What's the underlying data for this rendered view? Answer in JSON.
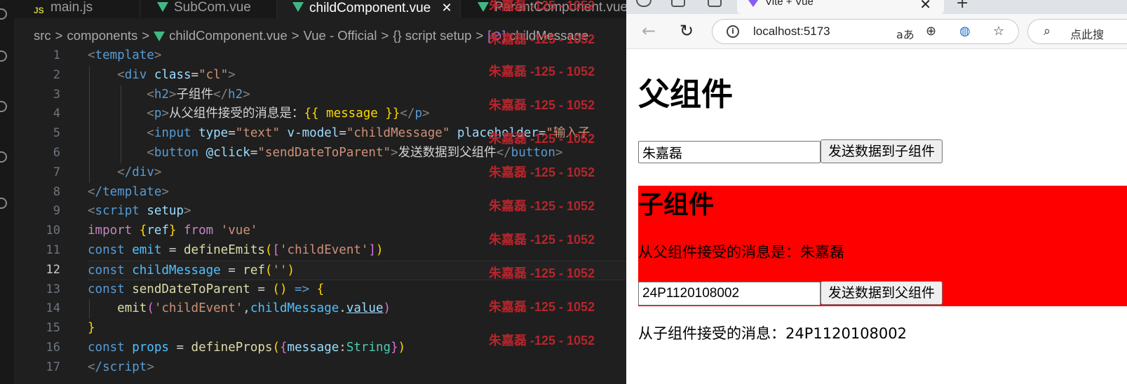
{
  "editor": {
    "tabs": [
      {
        "label": "main.js",
        "icon": "js-icon"
      },
      {
        "label": "SubCom.vue",
        "icon": "vue-icon"
      },
      {
        "label": "childComponent.vue",
        "icon": "vue-icon",
        "active": true
      },
      {
        "label": "ParentComponent.vue",
        "icon": "vue-icon"
      }
    ],
    "breadcrumb": [
      "src",
      "components",
      "childComponent.vue",
      "Vue - Official",
      "{} script setup",
      "childMessage"
    ],
    "line_numbers": [
      "1",
      "2",
      "3",
      "4",
      "5",
      "6",
      "7",
      "8",
      "9",
      "10",
      "11",
      "12",
      "13",
      "14",
      "15",
      "16",
      "17"
    ],
    "current_line": "12",
    "code": {
      "l1_tag": "template",
      "l2_tag": "div",
      "l2_attr": "class",
      "l2_val": "\"cl\"",
      "l3_tag": "h2",
      "l3_text": "子组件",
      "l4_tag": "p",
      "l4_text": "从父组件接受的消息是：",
      "l4_expr": "{{ message }}",
      "l5_tag": "input",
      "l5_a1": "type",
      "l5_v1": "\"text\"",
      "l5_a2": "v-model",
      "l5_v2": "\"childMessage\"",
      "l5_a3": "placeholder",
      "l5_v3": "\"输入子",
      "l6_tag": "button",
      "l6_attr": "@click",
      "l6_val": "\"sendDateToParent\"",
      "l6_text": "发送数据到父组件",
      "l7_tag": "/div",
      "l8_tag": "/template",
      "l9_tag": "script",
      "l9_attr": "setup",
      "l10_kw": "import",
      "l10_name": "ref",
      "l10_from": "from",
      "l10_mod": "'vue'",
      "l11_kw": "const",
      "l11_var": "emit",
      "l11_fn": "defineEmits",
      "l11_str": "'childEvent'",
      "l12_kw": "const",
      "l12_var": "childMessage",
      "l12_fn": "ref",
      "l12_str": "''",
      "l13_kw": "const",
      "l13_var": "sendDateToParent",
      "l14_fn": "emit",
      "l14_str": "'childEvent'",
      "l14_var": "childMessage",
      "l14_prop": "value",
      "l16_kw": "const",
      "l16_var": "props",
      "l16_fn": "defineProps",
      "l16_key": "message",
      "l16_type": "String",
      "l17_tag": "/script"
    },
    "watermark": "朱嘉磊 -125 - 1052"
  },
  "browser": {
    "tab_title": "Vite + Vue",
    "url": "localhost:5173",
    "search_placeholder": "点此搜",
    "reader_icon_text": "aあ",
    "page": {
      "title": "父组件",
      "parent_input_value": "朱嘉磊",
      "send_to_child_button": "发送数据到子组件",
      "child_title": "子组件",
      "child_message": "从父组件接受的消息是：朱嘉磊",
      "child_input_value": "24P1120108002",
      "send_to_parent_button": "发送数据到父组件",
      "received_message": "从子组件接受的消息：24P1120108002"
    }
  },
  "colors": {
    "editor_bg": "#1f1f1f",
    "child_box_bg": "#ff0000",
    "watermark": "#c4262e",
    "vue_green": "#41b883"
  }
}
